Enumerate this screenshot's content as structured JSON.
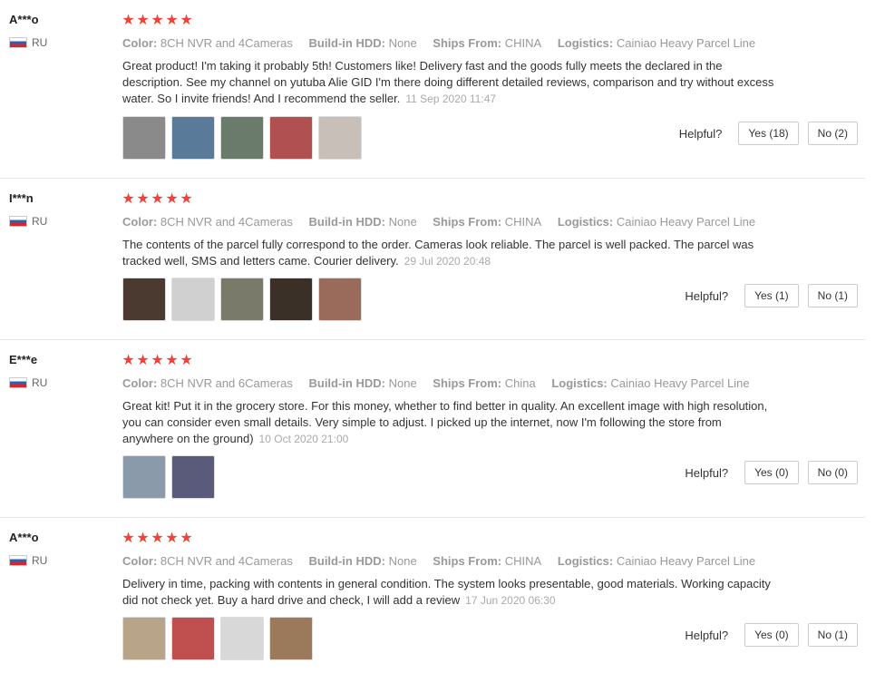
{
  "reviews": [
    {
      "user": "A***o",
      "country": "RU",
      "stars": [
        "★",
        "★",
        "★",
        "★",
        "★"
      ],
      "attrs": [
        {
          "k": "Color:",
          "v": "8CH NVR and 4Cameras"
        },
        {
          "k": "Build-in HDD:",
          "v": "None"
        },
        {
          "k": "Ships From:",
          "v": "CHINA"
        },
        {
          "k": "Logistics:",
          "v": "Cainiao Heavy Parcel Line"
        }
      ],
      "text": "Great product! I'm taking it probably 5th! Customers like! Delivery fast and the goods fully meets the declared in the description. See my channel on yutuba Alie GID I'm there doing different detailed reviews, comparison and try without excess water. So I invite friends! And I recommend the seller.",
      "date": "11 Sep 2020 11:47",
      "photos": [
        "#8a8a8a",
        "#5a7a9a",
        "#6b7b6b",
        "#b05050",
        "#c8c0b8"
      ],
      "helpful": "Helpful?",
      "yes": "Yes (18)",
      "no": "No (2)"
    },
    {
      "user": "I***n",
      "country": "RU",
      "stars": [
        "★",
        "★",
        "★",
        "★",
        "★"
      ],
      "attrs": [
        {
          "k": "Color:",
          "v": "8CH NVR and 4Cameras"
        },
        {
          "k": "Build-in HDD:",
          "v": "None"
        },
        {
          "k": "Ships From:",
          "v": "CHINA"
        },
        {
          "k": "Logistics:",
          "v": "Cainiao Heavy Parcel Line"
        }
      ],
      "text": "The contents of the parcel fully correspond to the order. Cameras look reliable. The parcel is well packed. The parcel was tracked well, SMS and letters came. Courier delivery.",
      "date": "29 Jul 2020 20:48",
      "photos": [
        "#4a3a30",
        "#d0d0d0",
        "#7a7a6a",
        "#3a3028",
        "#9a6a5a"
      ],
      "helpful": "Helpful?",
      "yes": "Yes (1)",
      "no": "No (1)"
    },
    {
      "user": "E***e",
      "country": "RU",
      "stars": [
        "★",
        "★",
        "★",
        "★",
        "★"
      ],
      "attrs": [
        {
          "k": "Color:",
          "v": "8CH NVR and 6Cameras"
        },
        {
          "k": "Build-in HDD:",
          "v": "None"
        },
        {
          "k": "Ships From:",
          "v": "China"
        },
        {
          "k": "Logistics:",
          "v": "Cainiao Heavy Parcel Line"
        }
      ],
      "text": "Great kit! Put it in the grocery store. For this money, whether to find better in quality. An excellent image with high resolution, you can consider even small details. Very simple to adjust. I picked up the internet, now I'm following the store from anywhere on the ground)",
      "date": "10 Oct 2020 21:00",
      "photos": [
        "#8a9aaa",
        "#5a5a7a"
      ],
      "helpful": "Helpful?",
      "yes": "Yes (0)",
      "no": "No (0)"
    },
    {
      "user": "A***o",
      "country": "RU",
      "stars": [
        "★",
        "★",
        "★",
        "★",
        "★"
      ],
      "attrs": [
        {
          "k": "Color:",
          "v": "8CH NVR and 4Cameras"
        },
        {
          "k": "Build-in HDD:",
          "v": "None"
        },
        {
          "k": "Ships From:",
          "v": "CHINA"
        },
        {
          "k": "Logistics:",
          "v": "Cainiao Heavy Parcel Line"
        }
      ],
      "text": "Delivery in time, packing with contents in general condition. The system looks presentable, good materials. Working capacity did not check yet. Buy a hard drive and check, I will add a review",
      "date": "17 Jun 2020 06:30",
      "photos": [
        "#b8a488",
        "#c05050",
        "#d8d8d8",
        "#9a7a5a"
      ],
      "helpful": "Helpful?",
      "yes": "Yes (0)",
      "no": "No (1)"
    }
  ]
}
